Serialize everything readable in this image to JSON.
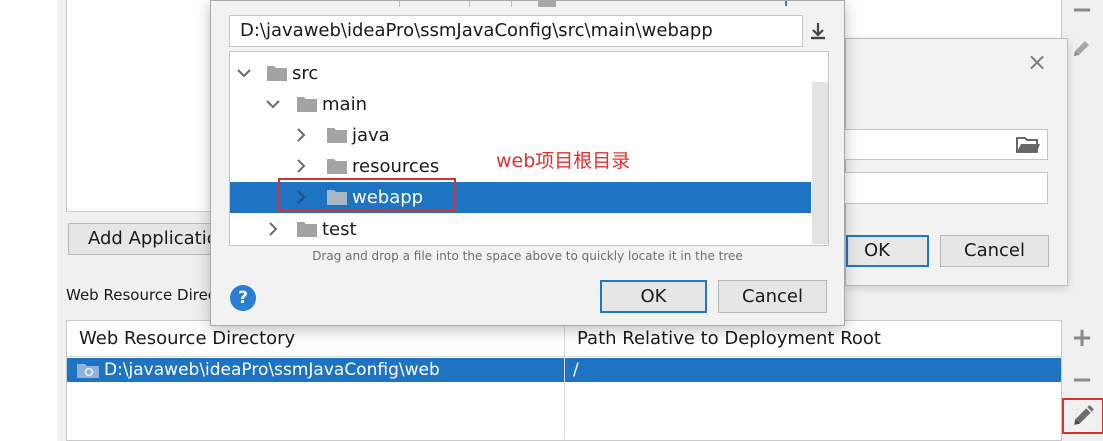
{
  "background": {
    "add_button_label": "Add Application Server specific descriptor...",
    "web_resource_label": "Web Resource Directories",
    "table": {
      "columns": [
        "Web Resource Directory",
        "Path Relative to Deployment Root"
      ],
      "rows": [
        {
          "directory": "D:\\javaweb\\ideaPro\\ssmJavaConfig\\web",
          "path": "/"
        }
      ]
    },
    "tools": {
      "plus": "+",
      "minus": "−",
      "edit_icon": "pencil-icon"
    }
  },
  "second_dialog": {
    "close": "×",
    "ok_label": "OK",
    "cancel_label": "Cancel"
  },
  "chooser": {
    "path": "D:\\javaweb\\ideaPro\\ssmJavaConfig\\src\\main\\webapp",
    "tree": [
      {
        "label": "src",
        "expanded": true
      },
      {
        "label": "main",
        "expanded": true
      },
      {
        "label": "java",
        "expanded": false
      },
      {
        "label": "resources",
        "expanded": false
      },
      {
        "label": "webapp",
        "expanded": false,
        "selected": true
      },
      {
        "label": "test",
        "expanded": false
      }
    ],
    "annotation": "web项目根目录",
    "drag_hint": "Drag and drop a file into the space above to quickly locate it in the tree",
    "help": "?",
    "ok_label": "OK",
    "cancel_label": "Cancel"
  },
  "colors": {
    "selection": "#1e74c2",
    "annotation_red": "#d6332f",
    "focus_blue": "#1f78c5"
  }
}
